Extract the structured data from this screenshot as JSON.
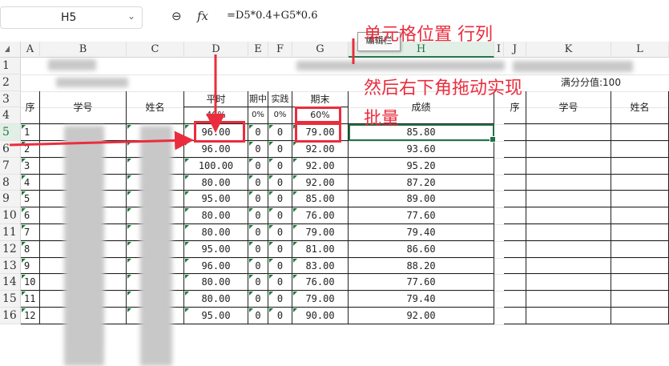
{
  "formula_bar": {
    "name_box": "H5",
    "name_box_caret": "⌄",
    "zoom_icon": "⊖",
    "fx_label": "fx",
    "formula": "=D5*0.4+G5*0.6"
  },
  "columns": [
    "A",
    "B",
    "C",
    "D",
    "E",
    "F",
    "G",
    "H",
    "I",
    "J",
    "K",
    "L"
  ],
  "rows": [
    "1",
    "2",
    "3",
    "4",
    "5",
    "6",
    "7",
    "8",
    "9",
    "10",
    "11",
    "12",
    "13",
    "14",
    "15",
    "16"
  ],
  "selected_column": "H",
  "selected_row": "5",
  "sheet": {
    "title_row2_right": "满分分值:100",
    "headers": {
      "seq": "序",
      "student_id": "学号",
      "name": "姓名",
      "regular": "平时",
      "midterm": "期中",
      "practice": "实践",
      "final": "期末",
      "score": "成绩",
      "regular_pct": "40%",
      "midterm_pct": "0%",
      "practice_pct": "0%",
      "final_pct": "60%",
      "right_seq": "序",
      "right_student_id": "学号",
      "right_name": "姓名"
    },
    "data_rows": [
      {
        "seq": "1",
        "regular": "96.00",
        "mid": "0",
        "prac": "0",
        "final": "79.00",
        "score": "85.80"
      },
      {
        "seq": "2",
        "regular": "96.00",
        "mid": "0",
        "prac": "0",
        "final": "92.00",
        "score": "93.60"
      },
      {
        "seq": "3",
        "regular": "100.00",
        "mid": "0",
        "prac": "0",
        "final": "92.00",
        "score": "95.20"
      },
      {
        "seq": "4",
        "regular": "80.00",
        "mid": "0",
        "prac": "0",
        "final": "92.00",
        "score": "87.20"
      },
      {
        "seq": "5",
        "regular": "95.00",
        "mid": "0",
        "prac": "0",
        "final": "85.00",
        "score": "89.00"
      },
      {
        "seq": "6",
        "regular": "80.00",
        "mid": "0",
        "prac": "0",
        "final": "76.00",
        "score": "77.60"
      },
      {
        "seq": "7",
        "regular": "80.00",
        "mid": "0",
        "prac": "0",
        "final": "79.00",
        "score": "79.40"
      },
      {
        "seq": "8",
        "regular": "95.00",
        "mid": "0",
        "prac": "0",
        "final": "81.00",
        "score": "86.60"
      },
      {
        "seq": "9",
        "regular": "96.00",
        "mid": "0",
        "prac": "0",
        "final": "83.00",
        "score": "88.20"
      },
      {
        "seq": "10",
        "regular": "80.00",
        "mid": "0",
        "prac": "0",
        "final": "76.00",
        "score": "77.60"
      },
      {
        "seq": "11",
        "regular": "80.00",
        "mid": "0",
        "prac": "0",
        "final": "79.00",
        "score": "79.40"
      },
      {
        "seq": "12",
        "regular": "95.00",
        "mid": "0",
        "prac": "0",
        "final": "90.00",
        "score": "92.00"
      }
    ]
  },
  "tooltip": "编辑栏",
  "annotations": {
    "line1": "单元格位置 行列",
    "line2": "然后右下角拖动实现",
    "line3": "批量"
  },
  "colors": {
    "accent": "#217346",
    "annotation_red": "#ea2d3e"
  }
}
